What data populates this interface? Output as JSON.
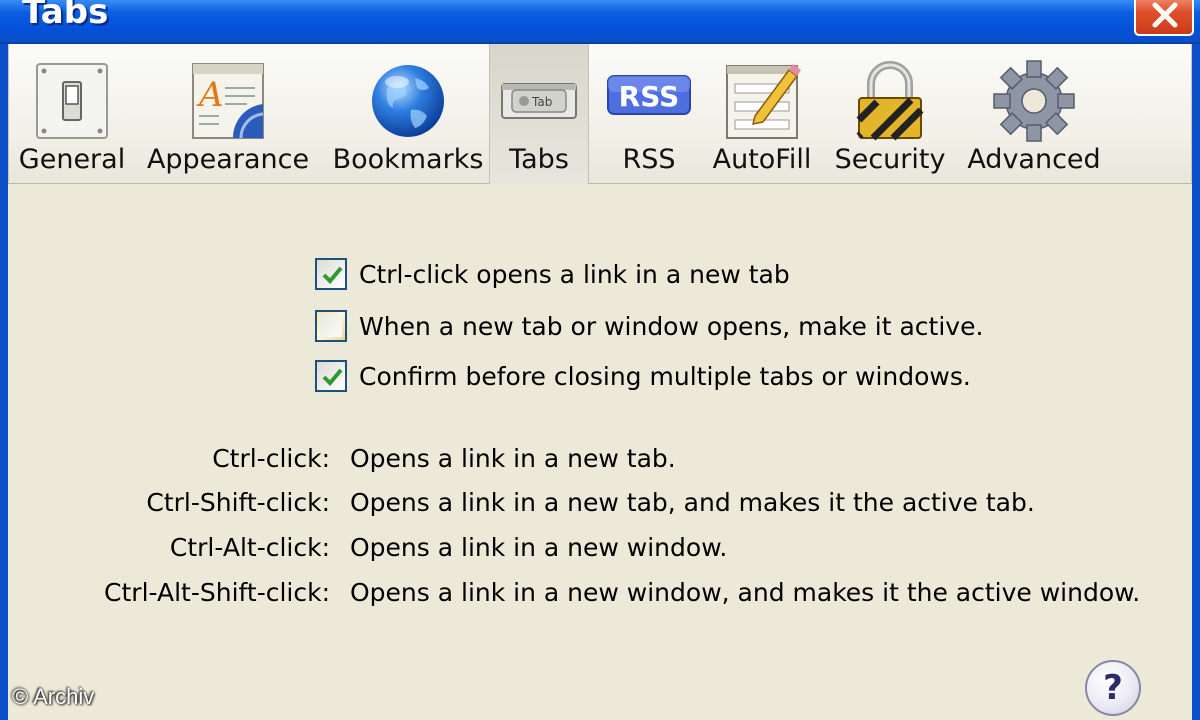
{
  "window": {
    "title": "Tabs"
  },
  "toolbar": {
    "items": [
      {
        "label": "General",
        "icon": "light-switch-icon"
      },
      {
        "label": "Appearance",
        "icon": "font-style-icon"
      },
      {
        "label": "Bookmarks",
        "icon": "globe-icon"
      },
      {
        "label": "Tabs",
        "icon": "tab-icon",
        "selected": true
      },
      {
        "label": "RSS",
        "icon": "rss-icon"
      },
      {
        "label": "AutoFill",
        "icon": "form-pencil-icon"
      },
      {
        "label": "Security",
        "icon": "padlock-icon"
      },
      {
        "label": "Advanced",
        "icon": "gear-icon"
      }
    ],
    "tab_icon_text": "Tab",
    "rss_icon_text": "RSS"
  },
  "options": [
    {
      "label": "Ctrl-click opens a link in a new tab",
      "checked": true
    },
    {
      "label": "When a new tab or window opens, make it active.",
      "checked": false
    },
    {
      "label": "Confirm before closing multiple tabs or windows.",
      "checked": true
    }
  ],
  "shortcuts": [
    {
      "key": "Ctrl-click:",
      "description": "Opens a link in a new tab."
    },
    {
      "key": "Ctrl-Shift-click:",
      "description": "Opens a link in a new tab, and makes it the active tab."
    },
    {
      "key": "Ctrl-Alt-click:",
      "description": "Opens a link in a new window."
    },
    {
      "key": "Ctrl-Alt-Shift-click:",
      "description": "Opens a link in a new window, and makes it the active window."
    }
  ],
  "help": {
    "label": "?"
  },
  "watermark": "© Archiv",
  "colors": {
    "titlebar": "#0a5fe0",
    "background": "#ece9d8",
    "checkmark": "#2f9a2f"
  }
}
